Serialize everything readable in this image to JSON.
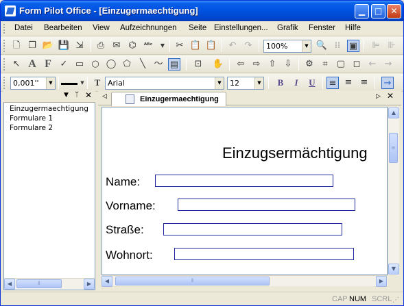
{
  "window": {
    "title": "Form Pilot Office - [Einzugermaechtigung]"
  },
  "menu": [
    "Datei",
    "Bearbeiten",
    "View",
    "Aufzeichnungen",
    "Seite",
    "Einstellungen...",
    "Grafik",
    "Fenster",
    "Hilfe"
  ],
  "toolbar": {
    "zoom": "100%"
  },
  "format": {
    "line_width": "0,001''",
    "font": "Arial",
    "font_size": "12",
    "bold": "B",
    "italic": "I",
    "underline": "U",
    "font_icon_label": "T"
  },
  "panel": {
    "items": [
      "Einzugermaechtigung",
      "Formulare 1",
      "Formulare 2"
    ]
  },
  "document": {
    "tab": "Einzugermaechtigung",
    "title": "Einzugsermächtigung",
    "labels": {
      "name": "Name:",
      "vorname": "Vorname:",
      "strasse": "Straße:",
      "wohnort": "Wohnort:"
    }
  },
  "status": {
    "cap": "CAP",
    "num": "NUM",
    "scrl": "SCRL"
  }
}
